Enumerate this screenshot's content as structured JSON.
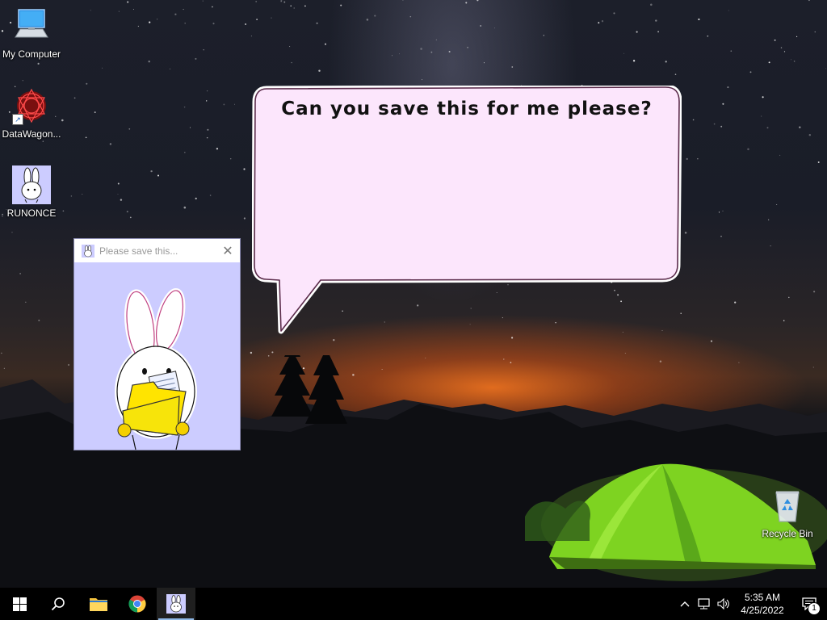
{
  "desktop": {
    "icons": [
      {
        "label": "My Computer",
        "icon": "computer-icon"
      },
      {
        "label": "DataWagon...",
        "icon": "datawagon-icon"
      },
      {
        "label": "RUNONCE",
        "icon": "bunny-icon"
      },
      {
        "label": "Recycle Bin",
        "icon": "recycle-bin-icon"
      }
    ]
  },
  "bubble": {
    "text": "Can you save this for me please?",
    "fill": "#fce6fc",
    "border": "#d08fd0"
  },
  "window": {
    "title": "Please save this...",
    "icon": "bunny-icon",
    "background": "#ccccff",
    "close_label": "✕"
  },
  "taskbar": {
    "buttons": [
      {
        "name": "start-button",
        "icon": "windows-logo-icon"
      },
      {
        "name": "search-button",
        "icon": "search-icon"
      },
      {
        "name": "file-explorer-button",
        "icon": "folder-icon"
      },
      {
        "name": "chrome-button",
        "icon": "chrome-icon"
      },
      {
        "name": "bunny-app-button",
        "icon": "bunny-icon",
        "active": true
      }
    ],
    "tray": {
      "icons": [
        "chevron-up-icon",
        "network-icon",
        "volume-icon"
      ],
      "time": "5:35 AM",
      "date": "4/25/2022",
      "notification_count": "1"
    }
  }
}
